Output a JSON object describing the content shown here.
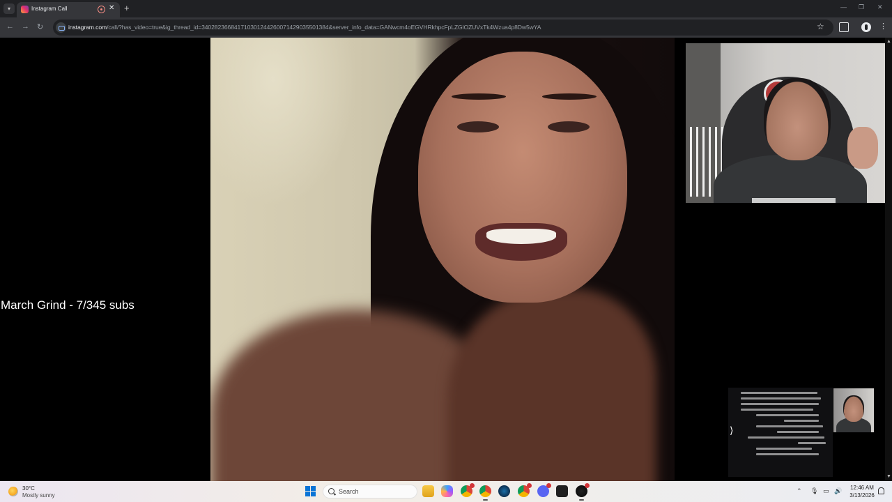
{
  "browser": {
    "tab_title": "Instagram Call",
    "url_host": "instagram.com",
    "url_path": "/call/?has_video=true&ig_thread_id=340282366841710301244260071429035501384&server_info_data=GANwcm4oEGVHRkhpcFpLZGlOZUVxTk4Wzua4p8Dw5wYA"
  },
  "stream": {
    "overlay_text": "March Grind - 7/345 subs"
  },
  "taskbar": {
    "weather_temp": "30°C",
    "weather_condition": "Mostly sunny",
    "search_placeholder": "Search",
    "time": "12:46 AM",
    "date": "3/13/2026"
  }
}
